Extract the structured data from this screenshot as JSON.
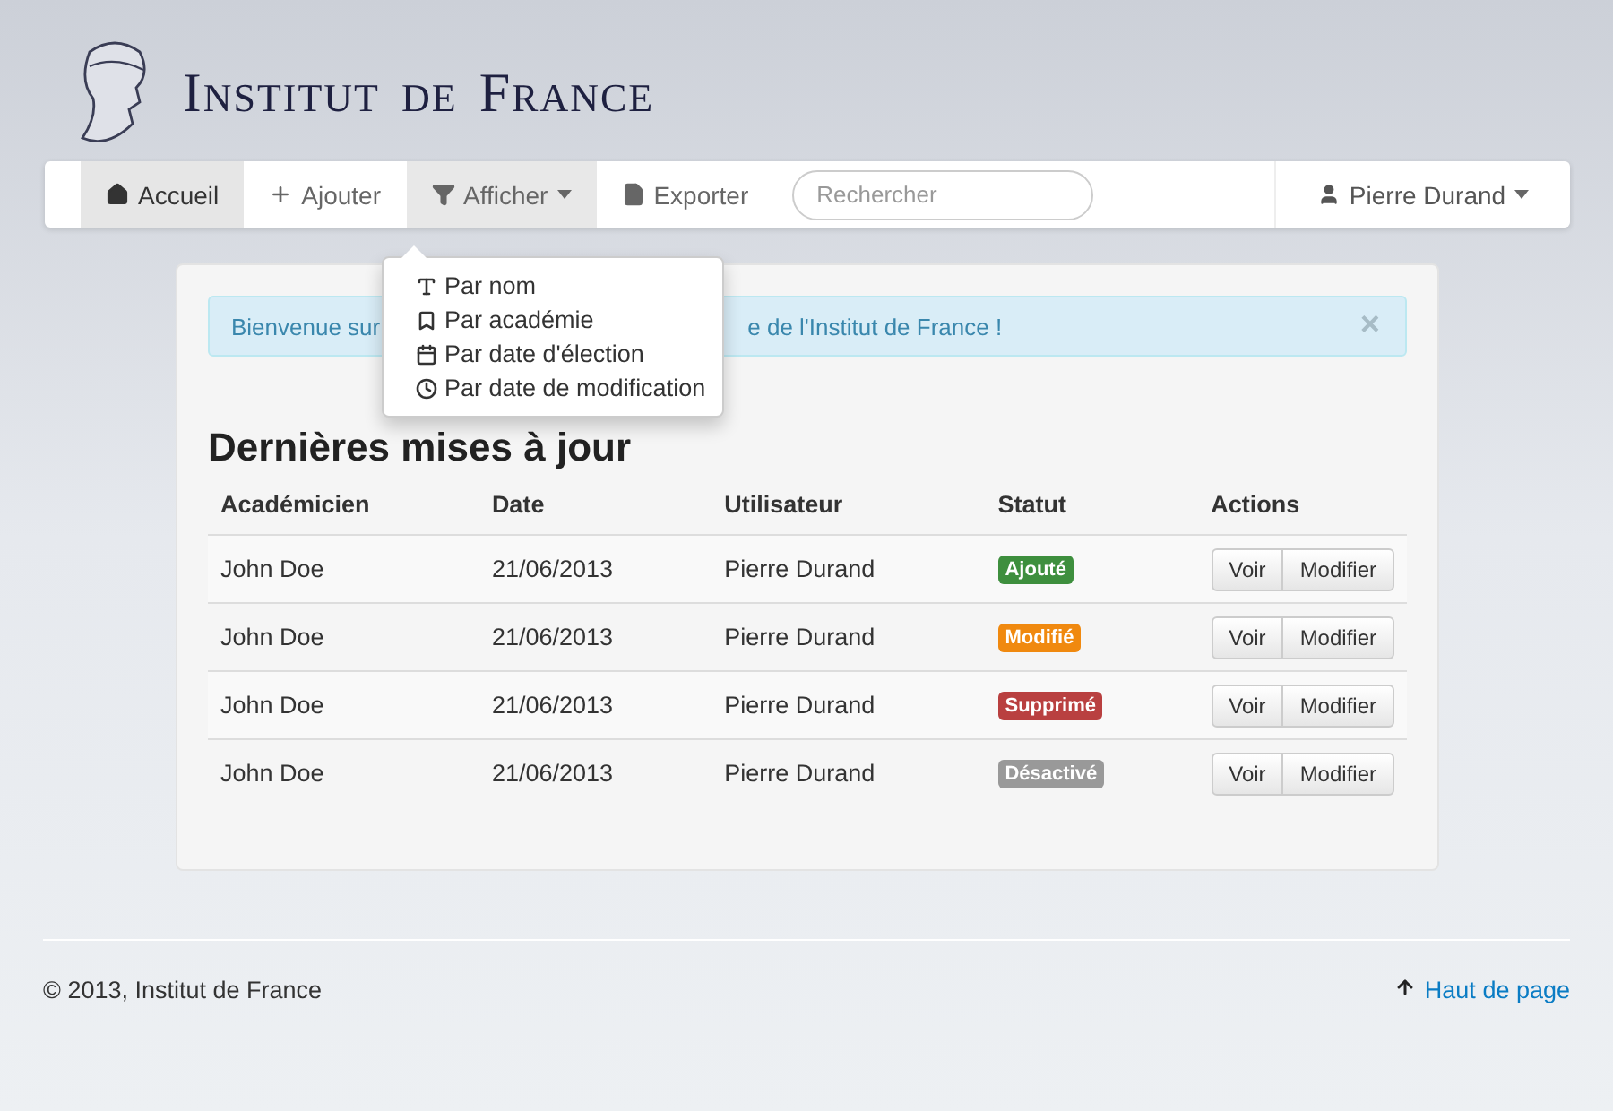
{
  "header": {
    "title_parts": [
      "Institut",
      "de",
      "France"
    ]
  },
  "navbar": {
    "items": [
      {
        "label": "Accueil",
        "selected": true,
        "expanded": false
      },
      {
        "label": "Ajouter",
        "selected": false,
        "expanded": false
      },
      {
        "label": "Afficher",
        "selected": false,
        "expanded": true
      },
      {
        "label": "Exporter",
        "selected": false,
        "expanded": false
      }
    ],
    "search": {
      "placeholder": "Rechercher"
    },
    "user": {
      "label": "Pierre Durand"
    }
  },
  "dropdown": {
    "items": [
      {
        "label": "Par nom"
      },
      {
        "label": "Par académie"
      },
      {
        "label": "Par date d'élection"
      },
      {
        "label": "Par date de modification"
      }
    ]
  },
  "alert": {
    "text_parts": [
      "Bienvenue sur",
      "e de l'Institut de France !"
    ],
    "close": "×"
  },
  "heading": "Dernières mises à jour",
  "table": {
    "columns": [
      "Académicien",
      "Date",
      "Utilisateur",
      "Statut",
      "Actions"
    ],
    "rows": [
      {
        "academician": "John Doe",
        "date": "21/06/2013",
        "user": "Pierre Durand",
        "status": "Ajouté",
        "color": "#3e8f3e",
        "actions": [
          "Voir",
          "Modifier"
        ]
      },
      {
        "academician": "John Doe",
        "date": "21/06/2013",
        "user": "Pierre Durand",
        "status": "Modifié",
        "color": "#f0890f",
        "actions": [
          "Voir",
          "Modifier"
        ]
      },
      {
        "academician": "John Doe",
        "date": "21/06/2013",
        "user": "Pierre Durand",
        "status": "Supprimé",
        "color": "#b94040",
        "actions": [
          "Voir",
          "Modifier"
        ]
      },
      {
        "academician": "John Doe",
        "date": "21/06/2013",
        "user": "Pierre Durand",
        "status": "Désactivé",
        "color": "#999999",
        "actions": [
          "Voir",
          "Modifier"
        ]
      }
    ]
  },
  "footer": {
    "copyright": "© 2013, Institut de France",
    "top_link": "Haut de page"
  }
}
